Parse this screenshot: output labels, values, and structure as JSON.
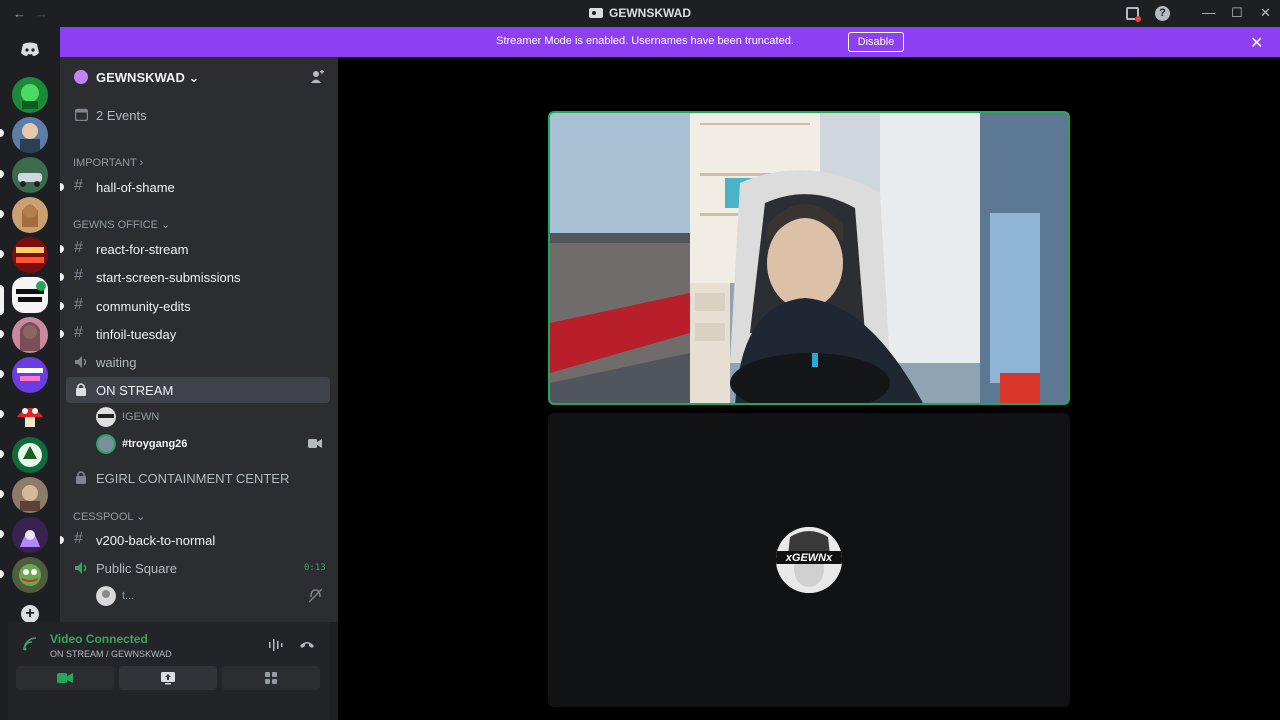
{
  "titlebar": {
    "title": "GEWNSKWAD",
    "back": "←",
    "forward": "→",
    "help": "?",
    "minimize": "—",
    "maximize": "☐",
    "close": "✕"
  },
  "banner": {
    "message": "Streamer Mode is enabled. Usernames have been truncated.",
    "button": "Disable",
    "close": "✕"
  },
  "guild": {
    "name": "GEWNSKWAD",
    "caret": "⌄"
  },
  "events": {
    "label": "2 Events"
  },
  "categories": {
    "important": "IMPORTANT ›",
    "gewns_office": "GEWNS OFFICE ⌄",
    "cesspool": "CESSPOOL ⌄"
  },
  "channels": {
    "hall_of_shame": "hall-of-shame",
    "react_for_stream": "react-for-stream",
    "start_screen": "start-screen-submissions",
    "community_edits": "community-edits",
    "tinfoil_tuesday": "tinfoil-tuesday",
    "waiting": "waiting",
    "on_stream": "ON STREAM",
    "egirl": "EGIRL CONTAINMENT CENTER",
    "v200": "v200-back-to-normal",
    "public_square": "Public Square",
    "public_square_timer": "0:13"
  },
  "voice_users": {
    "on_stream_1": "!GEWN",
    "on_stream_2": "#troygang26",
    "public_square_1": "t..."
  },
  "voice_panel": {
    "status": "Video Connected",
    "location": "ON STREAM / GEWNSKWAD"
  },
  "add_server": "+",
  "colors": {
    "banner": "#8c40f2",
    "connected": "#23a55a",
    "sidebar": "#2b2d31",
    "rail": "#1e1f22"
  },
  "icons": [
    "discord-icon",
    "calendar-icon",
    "hash-icon",
    "speaker-icon",
    "lock-icon",
    "camera-icon",
    "screen-share-icon",
    "activities-icon",
    "disconnect-icon",
    "signal-icon",
    "add-member-icon"
  ]
}
